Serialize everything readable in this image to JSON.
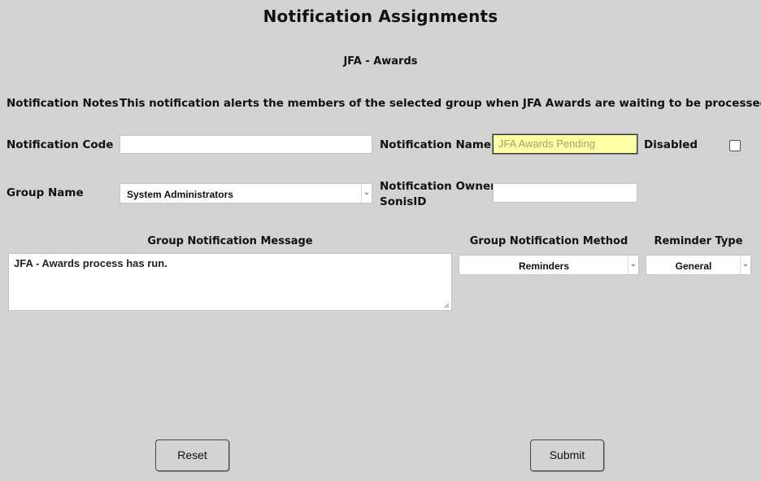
{
  "page": {
    "title": "Notification Assignments",
    "subtitle": "JFA - Awards"
  },
  "notes": {
    "label": "Notification Notes",
    "text": "This notification alerts the members of the selected group when JFA Awards are waiting to be processed."
  },
  "code": {
    "label": "Notification Code",
    "value": ""
  },
  "name": {
    "label": "Notification Name",
    "value": "JFA Awards Pending"
  },
  "disabled": {
    "label": "Disabled",
    "checked": false
  },
  "group": {
    "label": "Group Name",
    "value": "System Administrators"
  },
  "owner": {
    "label_line1": "Notification Owner",
    "label_line2": "SonisID",
    "value": ""
  },
  "message": {
    "label": "Group Notification Message",
    "value": "JFA - Awards process has run."
  },
  "method": {
    "label": "Group Notification Method",
    "value": "Reminders"
  },
  "reminder": {
    "label": "Reminder Type",
    "value": "General"
  },
  "buttons": {
    "reset": "Reset",
    "submit": "Submit"
  }
}
